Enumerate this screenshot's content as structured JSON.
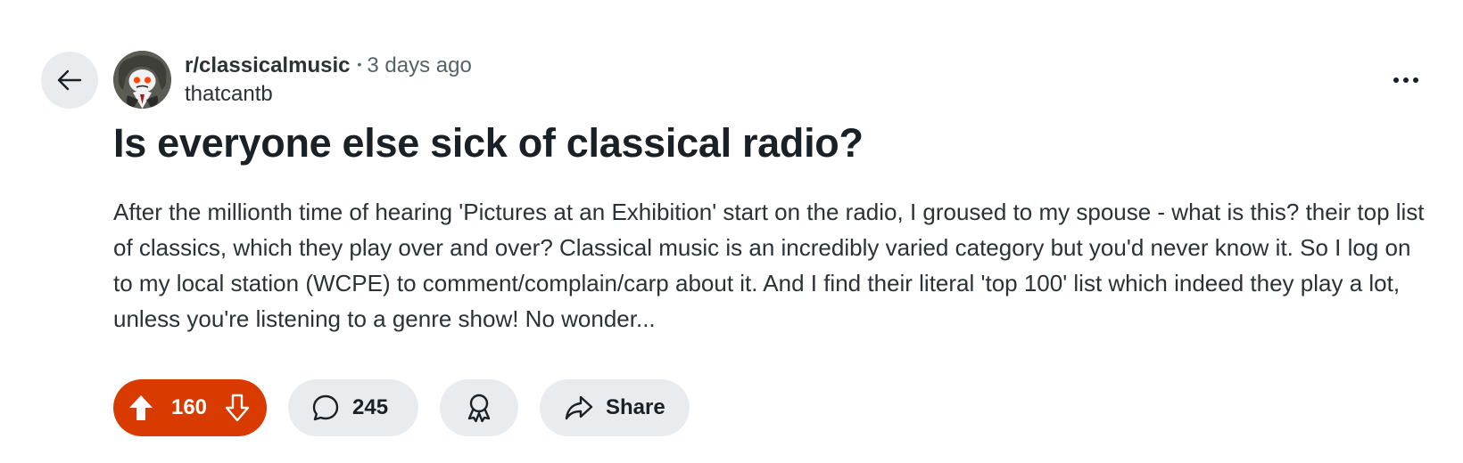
{
  "post": {
    "subreddit": "r/classicalmusic",
    "separator": "•",
    "time_ago": "3 days ago",
    "author": "thatcantb",
    "title": "Is everyone else sick of classical radio?",
    "body": "After the millionth time of hearing 'Pictures at an Exhibition' start on the radio, I groused to my spouse - what is this? their top list of classics, which they play over and over? Classical music is an incredibly varied category but you'd never know it. So I log on to my local station (WCPE) to comment/complain/carp about it. And I find their literal 'top 100' list which indeed they play a lot, unless you're listening to a genre show! No wonder..."
  },
  "actions": {
    "vote_count": "160",
    "comment_count": "245",
    "share_label": "Share"
  },
  "icons": {
    "back": "arrow-left-icon",
    "more": "ellipsis-icon",
    "upvote": "upvote-arrow-icon",
    "downvote": "downvote-arrow-icon",
    "comment": "speech-bubble-icon",
    "award": "award-ribbon-icon",
    "share": "share-arrow-icon"
  },
  "colors": {
    "vote_active": "#d93a00",
    "pill_bg": "#e9ecee",
    "text_primary": "#1a2126",
    "text_secondary": "#56626a"
  }
}
